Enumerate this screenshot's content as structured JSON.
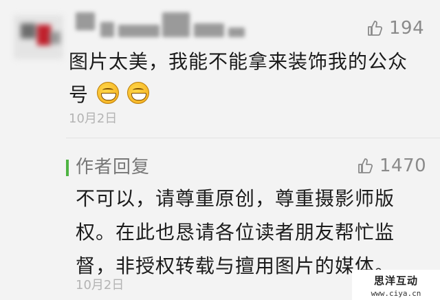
{
  "comment": {
    "nickname": "",
    "like_count": "194",
    "text_line1": "图片太美，我能不能拿来装饰我的公众",
    "text_line2": "号",
    "emojis": [
      "grinning-face",
      "grinning-face"
    ],
    "date": "10月2日"
  },
  "reply": {
    "label": "作者回复",
    "like_count": "1470",
    "text_line1": "不可以，请尊重原创，尊重摄影师版",
    "text_line2": "权。在此也恳请各位读者朋友帮忙监",
    "text_line3": "督，非授权转载与擅用图片的媒体。",
    "date": "10月2日"
  },
  "watermark": {
    "brand": "思洋互动",
    "url": "www.ciya.cn"
  },
  "colors": {
    "background": "#f3f3f3",
    "text": "#1b1b1b",
    "muted": "#8a8a8a",
    "accent_green": "#4fb443"
  }
}
